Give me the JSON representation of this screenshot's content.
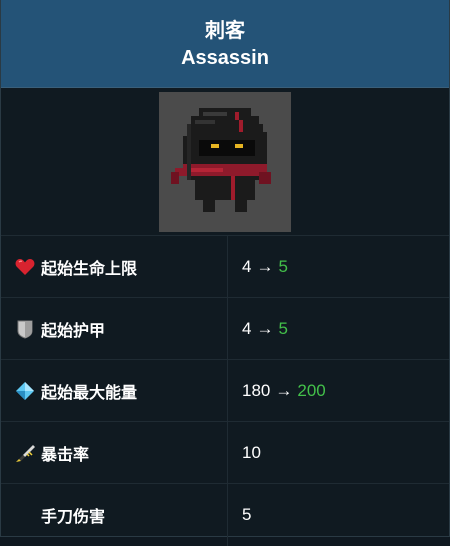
{
  "header": {
    "title_cn": "刺客",
    "title_en": "Assassin"
  },
  "portrait": {
    "icon": "assassin-character-sprite"
  },
  "stats": [
    {
      "label": "起始生命上限",
      "icon": "heart-icon",
      "base": "4",
      "arrow": "→",
      "upgraded": "5"
    },
    {
      "label": "起始护甲",
      "icon": "shield-icon",
      "base": "4",
      "arrow": "→",
      "upgraded": "5"
    },
    {
      "label": "起始最大能量",
      "icon": "energy-crystal-icon",
      "base": "180",
      "arrow": "→",
      "upgraded": "200"
    },
    {
      "label": "暴击率",
      "icon": "crit-dagger-icon",
      "base": "10"
    },
    {
      "label": "手刀伤害",
      "icon": "",
      "base": "5"
    }
  ],
  "colors": {
    "header_bg": "#245377",
    "card_bg": "#101a21",
    "upgrade_green": "#43c04a"
  }
}
